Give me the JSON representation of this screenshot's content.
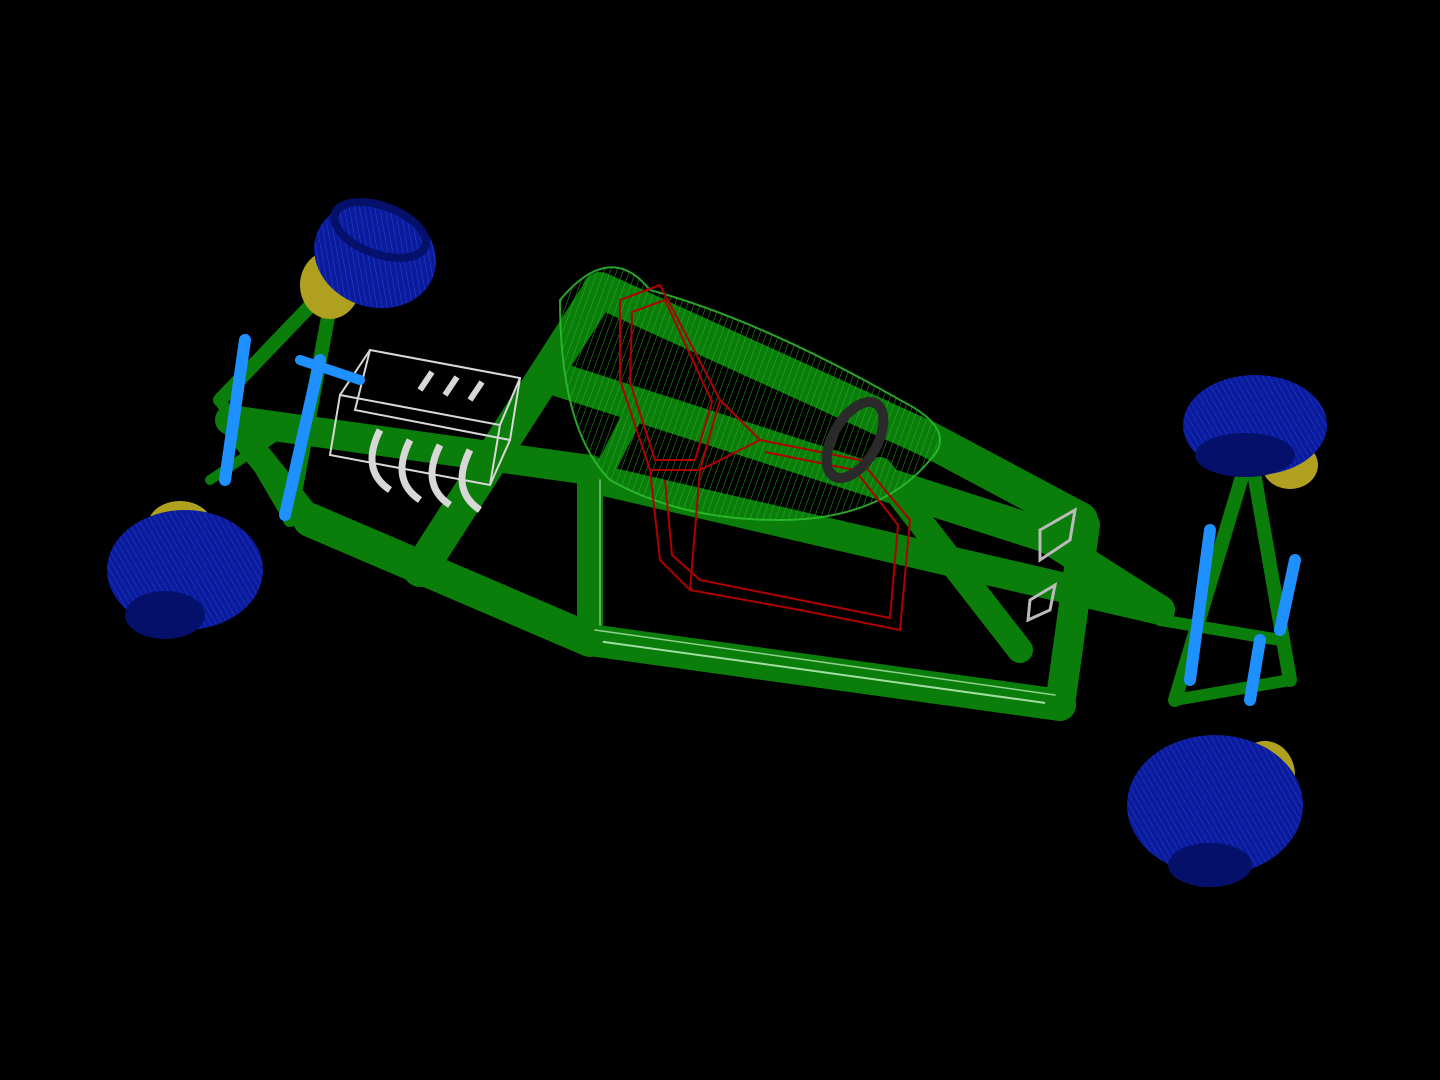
{
  "scene": {
    "subject": "wireframe-chassis-render",
    "colors": {
      "background": "#000000",
      "frame": "#0a7d0a",
      "frame_light": "#2fbf2f",
      "frame_highlight": "#c8f5c8",
      "seat": "#b00000",
      "engine": "#d8d8d8",
      "wheel": "#0a1c9c",
      "wheel_dark": "#04106a",
      "hub": "#b0a020",
      "damper": "#1e90ff",
      "dark_part": "#2a2a2a"
    },
    "parts": [
      "frame-tube",
      "seat",
      "engine",
      "wheel",
      "hub",
      "damper",
      "suspension-arm",
      "steering-wheel"
    ]
  }
}
